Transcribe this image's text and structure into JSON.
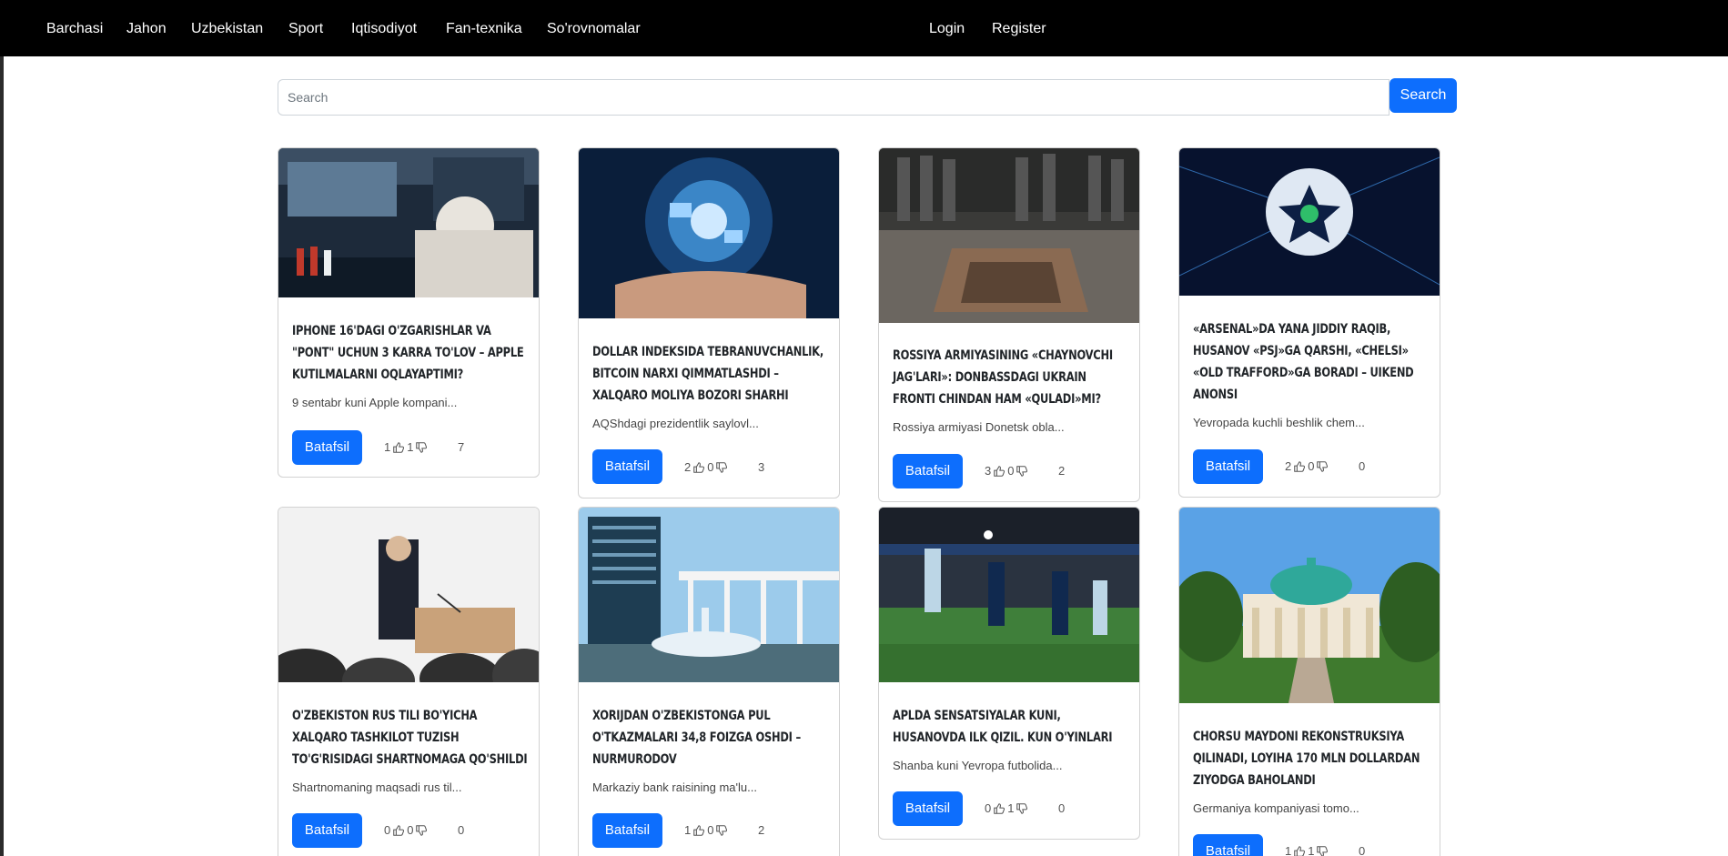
{
  "nav": {
    "items": [
      "Barchasi",
      "Jahon",
      "Uzbekistan",
      "Sport",
      "Iqtisodiyot",
      "Fan-texnika",
      "So'rovnomalar"
    ],
    "login": "Login",
    "register": "Register"
  },
  "search": {
    "placeholder": "Search",
    "value": "",
    "button": "Search"
  },
  "colors": {
    "primary": "#0d6efd",
    "navbar": "#000000"
  },
  "icons": {
    "like": "thumb-up-icon",
    "dislike": "thumb-down-icon",
    "views": "eye-icon"
  },
  "cards": [
    {
      "title": "iPhone 16'dagi o'zgarishlar va \"Pont\" uchun 3 karra to'lov – Apple kutilmalarni oqlayaptimi?",
      "desc": "9 sentabr kuni Apple kompani...",
      "button": "Batafsil",
      "likes": "1",
      "dislikes": "1",
      "views": "7"
    },
    {
      "title": "Dollar indeksida tebranuvchanlik, bitcoin narxi qimmatlashdi – xalqaro moliya bozori sharhi",
      "desc": "AQShdagi prezidentlik saylovl...",
      "button": "Batafsil",
      "likes": "2",
      "dislikes": "0",
      "views": "3"
    },
    {
      "title": "Rossiya armiyasining «chaynovchi jag'lari»: Donbassdagi Ukrain fronti chindan ham «quladi»mi?",
      "desc": "Rossiya armiyasi Donetsk obla...",
      "button": "Batafsil",
      "likes": "3",
      "dislikes": "0",
      "views": "2"
    },
    {
      "title": "«Arsenal»da yana jiddiy raqib, Husanov «PSJ»ga qarshi, «Chelsi» «Old Trafford»ga boradi – uikend anonsi",
      "desc": "Yevropada kuchli beshlik chem...",
      "button": "Batafsil",
      "likes": "2",
      "dislikes": "0",
      "views": "0"
    },
    {
      "title": "O'zbekiston rus tili bo'yicha xalqaro tashkilot tuzish to'g'risidagi shartnomaga qo'shildi",
      "desc": "Shartnomaning maqsadi rus til...",
      "button": "Batafsil",
      "likes": "0",
      "dislikes": "0",
      "views": "0"
    },
    {
      "title": "Xorijdan O'zbekistonga pul o'tkazmalari 34,8 foizga oshdi – Nurmurodov",
      "desc": "Markaziy bank raisining ma'lu...",
      "button": "Batafsil",
      "likes": "1",
      "dislikes": "0",
      "views": "2"
    },
    {
      "title": "APLda sensatsiyalar kuni, Husanovda ilk qizil. Kun o'yinlari",
      "desc": "Shanba kuni Yevropa futbolida...",
      "button": "Batafsil",
      "likes": "0",
      "dislikes": "1",
      "views": "0"
    },
    {
      "title": "Chorsu maydoni rekonstruksiya qilinadi, loyiha 170 mln dollardan ziyodga baholandi",
      "desc": "Germaniya kompaniyasi tomo...",
      "button": "Batafsil",
      "likes": "1",
      "dislikes": "1",
      "views": "0"
    }
  ]
}
